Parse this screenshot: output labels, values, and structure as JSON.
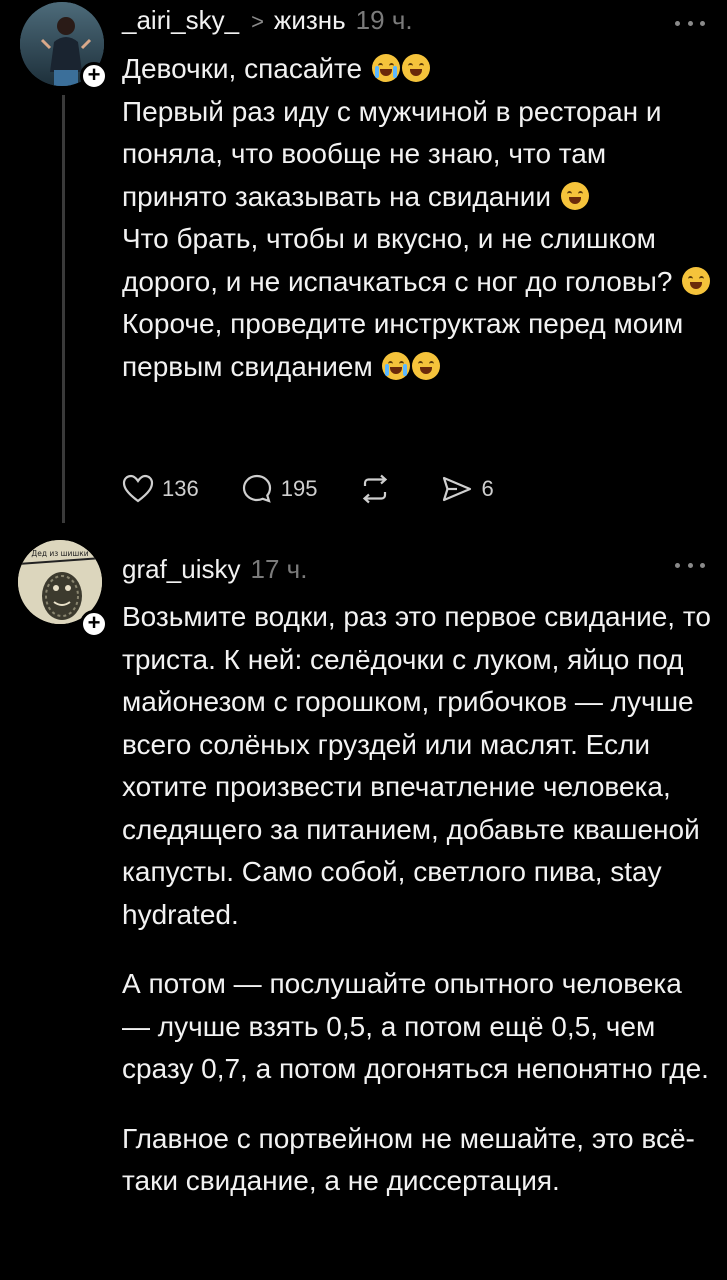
{
  "posts": [
    {
      "username": "_airi_sky_",
      "crumb_separator": ">",
      "topic": "жизнь",
      "time": "19 ч.",
      "avatar_icon": "avatar-photo",
      "follow_symbol": "+",
      "lines": [
        "Девочки, спасайте",
        "Первый раз иду с мужчиной в ресторан и поняла, что вообще не знаю, что там принято заказывать на свидании",
        "Что брать, чтобы и вкусно, и не слишком дорого, и не испачкаться с ног до головы?",
        "Короче, проведите инструктаж перед моим первым свиданием"
      ],
      "actions": {
        "likes": "136",
        "comments": "195",
        "reposts": "",
        "shares": "6"
      }
    },
    {
      "username": "graf_uisky",
      "time": "17 ч.",
      "avatar_icon": "avatar-book-cover",
      "avatar_text": "Дед из шишки",
      "follow_symbol": "+",
      "paragraphs": [
        "Возьмите водки, раз это первое свидание, то триста. К ней:  селёдочки с луком, яйцо под майонезом с горошком, грибочков — лучше всего солёных груздей или маслят. Если хотите произвести впечатление человека, следящего за питанием, добавьте квашеной капусты. Само собой, светлого пива, stay hydrated.",
        "А потом — послушайте опытного человека — лучше взять 0,5, а потом ещё 0,5, чем сразу 0,7, а потом догоняться непонятно где.",
        "Главное с портвейном не мешайте, это всё-таки свидание, а не диссертация."
      ]
    }
  ],
  "colors": {
    "background": "#000000",
    "text": "#f2f2f2",
    "muted": "#7b7b7b",
    "thread_line": "#3a3a3a"
  }
}
